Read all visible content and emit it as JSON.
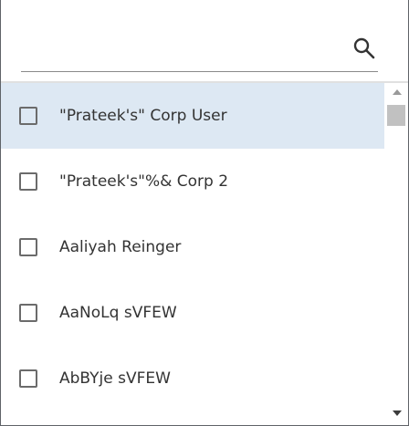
{
  "search": {
    "value": "",
    "placeholder": "",
    "icon": "search-icon"
  },
  "list": {
    "items": [
      {
        "label": "\"Prateek's\" Corp User",
        "checked": false,
        "highlighted": true
      },
      {
        "label": "\"Prateek's\"%& Corp 2",
        "checked": false,
        "highlighted": false
      },
      {
        "label": "Aaliyah Reinger",
        "checked": false,
        "highlighted": false
      },
      {
        "label": "AaNoLq sVFEW",
        "checked": false,
        "highlighted": false
      },
      {
        "label": "AbBYje sVFEW",
        "checked": false,
        "highlighted": false
      }
    ]
  },
  "colors": {
    "highlight": "#dde8f3",
    "text": "#333333",
    "checkbox_border": "#6b6b6b"
  }
}
